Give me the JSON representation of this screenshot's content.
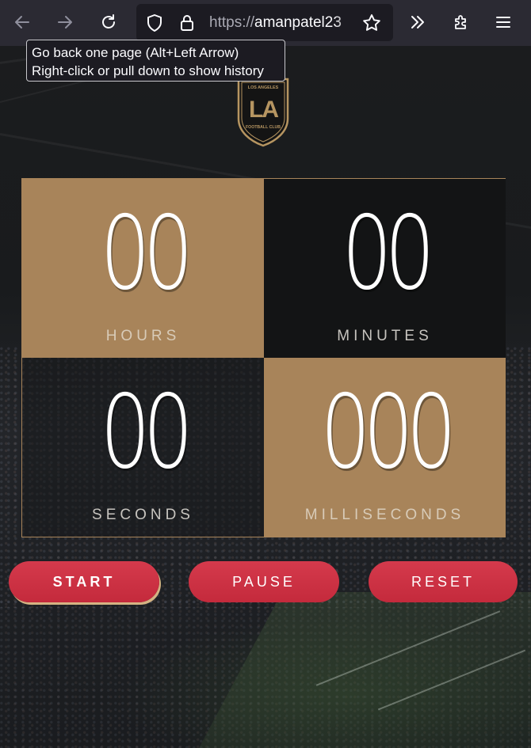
{
  "browser": {
    "url_scheme": "https://",
    "url_host": "amanpatel23",
    "back_tooltip_line1": "Go back one page (Alt+Left Arrow)",
    "back_tooltip_line2": "Right-click or pull down to show history",
    "icons": [
      "back-arrow-icon",
      "forward-arrow-icon",
      "reload-icon",
      "shield-icon",
      "lock-icon",
      "bookmark-star-icon",
      "overflow-chevrons-icon",
      "extensions-icon",
      "menu-icon"
    ]
  },
  "logo": {
    "top_text": "LOS ANGELES",
    "monogram": "LA",
    "bottom_text": "FOOTBALL CLUB",
    "color": "#b69561"
  },
  "stopwatch": {
    "hours": {
      "value": "00",
      "label": "HOURS"
    },
    "minutes": {
      "value": "00",
      "label": "MINUTES"
    },
    "seconds": {
      "value": "00",
      "label": "SECONDS"
    },
    "milliseconds": {
      "value": "000",
      "label": "MILLISECONDS"
    }
  },
  "controls": {
    "start": "START",
    "pause": "PAUSE",
    "reset": "RESET"
  },
  "colors": {
    "tan": "#a8845a",
    "button_red": "#cf3346",
    "chrome_bg": "#2b2a33"
  }
}
